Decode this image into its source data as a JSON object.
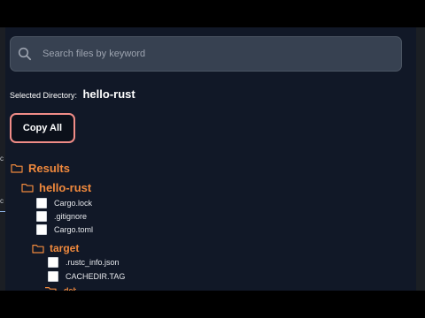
{
  "search": {
    "placeholder": "Search files by keyword",
    "value": ""
  },
  "selected_directory": {
    "label": "Selected Directory:",
    "value": "hello-rust"
  },
  "copy_all_label": "Copy All",
  "tree": {
    "root_label": "Results",
    "project_label": "hello-rust",
    "project_files": [
      {
        "name": "Cargo.lock",
        "checked": false
      },
      {
        "name": ".gitignore",
        "checked": false
      },
      {
        "name": "Cargo.toml",
        "checked": false
      }
    ],
    "target_label": "target",
    "target_files": [
      {
        "name": ".rustc_info.json",
        "checked": false
      },
      {
        "name": "CACHEDIR.TAG",
        "checked": false
      }
    ],
    "partial_folder_label": "deb"
  },
  "colors": {
    "panel_bg": "#111827",
    "search_bg": "#374151",
    "folder_accent": "#f0893d",
    "button_border": "#f08c87"
  },
  "icons": {
    "search": "search-icon",
    "folder": "folder-outline-icon",
    "checkbox": "checkbox-icon"
  }
}
